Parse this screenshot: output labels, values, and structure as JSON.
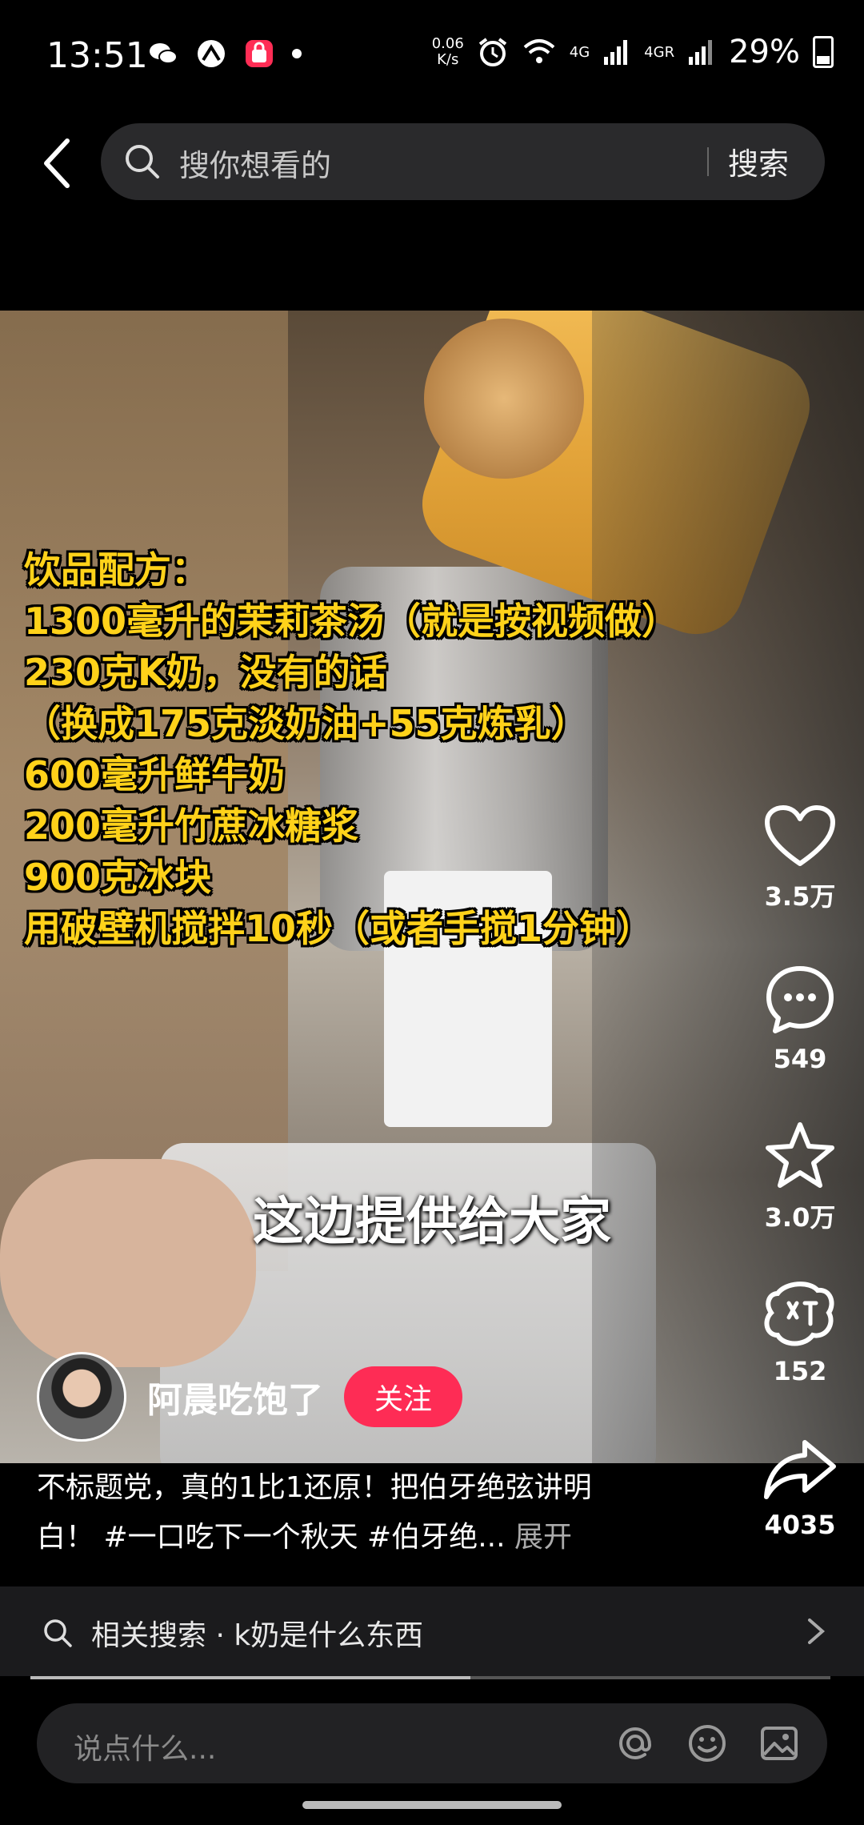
{
  "status": {
    "time": "13:51",
    "speed": "0.06",
    "speed_unit": "K/s",
    "net1": "4G",
    "net2": "4GR",
    "battery": "29%"
  },
  "search": {
    "placeholder": "搜你想看的",
    "button": "搜索"
  },
  "recipe": [
    "饮品配方：",
    "1300毫升的茉莉茶汤（就是按视频做）",
    "230克K奶，没有的话",
    "（换成175克淡奶油+55克炼乳）",
    "600毫升鲜牛奶",
    "200毫升竹蔗冰糖浆",
    "900克冰块",
    "用破壁机搅拌10秒（或者手搅1分钟）"
  ],
  "subtitle": "这边提供给大家",
  "actions": {
    "likes": "3.5万",
    "comments": "549",
    "favorites": "3.0万",
    "shares_label": "152",
    "forwards": "4035"
  },
  "author": {
    "name": "阿晨吃饱了",
    "follow": "关注"
  },
  "caption": {
    "line1": "不标题党，真的1比1还原！把伯牙绝弦讲明",
    "line2": "白！ #一口吃下一个秋天 #伯牙绝...",
    "expand": "展开"
  },
  "related": {
    "text": "相关搜索 · k奶是什么东西"
  },
  "progress": {
    "fraction": 0.55
  },
  "comment": {
    "placeholder": "说点什么..."
  },
  "colors": {
    "accent": "#fe2c55",
    "recipe_text": "#ffd21a"
  }
}
